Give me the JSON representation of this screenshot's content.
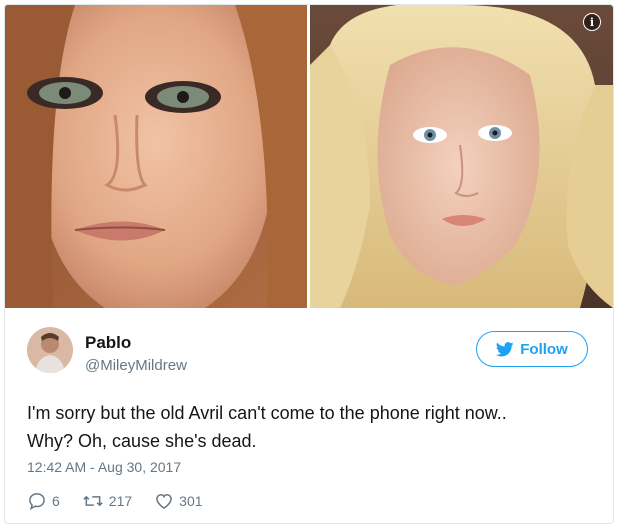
{
  "media": {
    "photos": [
      {
        "name": "left-photo",
        "description_color": "#c9805f"
      },
      {
        "name": "right-photo",
        "description_color": "#e7cf97"
      }
    ],
    "info_icon": "info-icon"
  },
  "author": {
    "name": "Pablo",
    "handle": "@MileyMildrew",
    "avatar_icon": "avatar"
  },
  "follow": {
    "label": "Follow",
    "icon": "twitter-bird-icon",
    "color": "#1da1f2"
  },
  "tweet": {
    "line1": "I'm sorry but the old Avril can't come to the phone right now..",
    "line2": "Why? Oh, cause she's dead."
  },
  "timestamp": "12:42 AM - Aug 30, 2017",
  "actions": {
    "replies": {
      "icon": "reply-icon",
      "count": "6"
    },
    "retweets": {
      "icon": "retweet-icon",
      "count": "217"
    },
    "likes": {
      "icon": "heart-icon",
      "count": "301"
    }
  },
  "colors": {
    "secondary_text": "#657786",
    "primary_text": "#14171a",
    "border": "#e1e8ed"
  }
}
